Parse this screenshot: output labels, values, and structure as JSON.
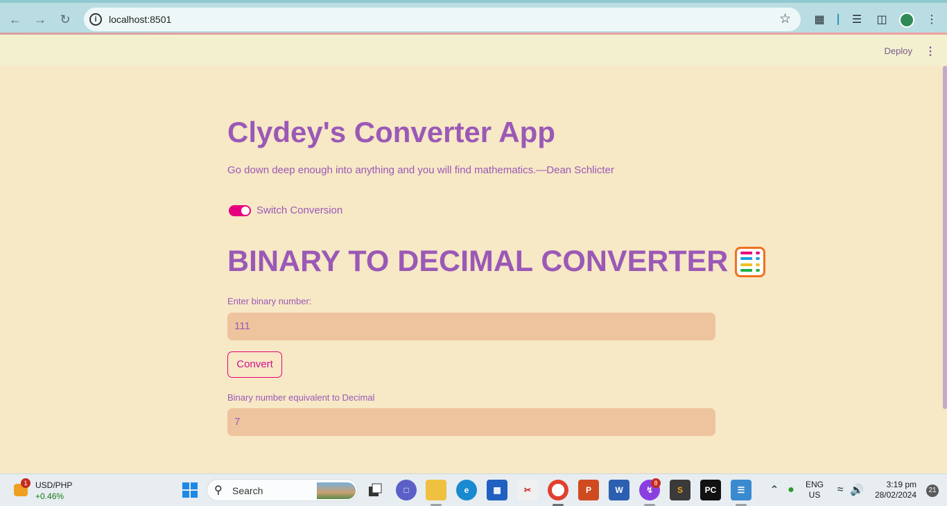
{
  "browser": {
    "url": "localhost:8501",
    "back_icon": "arrow-left-icon",
    "forward_icon": "arrow-right-icon",
    "reload_icon": "reload-icon"
  },
  "header": {
    "deploy_label": "Deploy"
  },
  "app": {
    "title": "Clydey's Converter App",
    "quote": "Go down deep enough into anything and you will find mathematics.—Dean Schlicter",
    "toggle_label": "Switch Conversion",
    "toggle_on": true,
    "heading": "BINARY TO DECIMAL CONVERTER",
    "heading_emoji": "abacus-icon",
    "input_label": "Enter binary number:",
    "input_value": "111",
    "convert_label": "Convert",
    "output_label": "Binary number equivalent to Decimal",
    "output_value": "7",
    "accent_color": "#9b59b6",
    "toggle_color": "#e6007e",
    "background_color": "#f7e8c6",
    "field_color": "#eec49e"
  },
  "taskbar": {
    "ticker_badge": "1",
    "ticker_pair": "USD/PHP",
    "ticker_change": "+0.46%",
    "search_label": "Search",
    "messenger_badge": "8",
    "lang_line1": "ENG",
    "lang_line2": "US",
    "time": "3:19 pm",
    "date": "28/02/2024",
    "notification_count": "21"
  }
}
